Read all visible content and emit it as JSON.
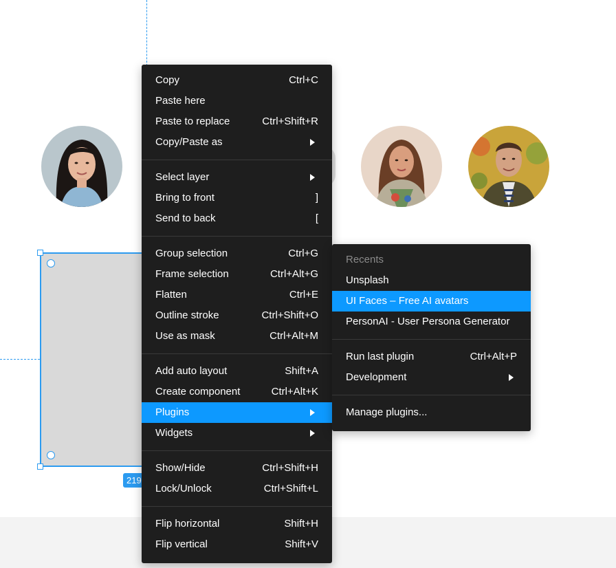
{
  "colors": {
    "accent": "#0d99ff",
    "selection": "#2c9bf0",
    "menu_bg": "#1e1e1e",
    "menu_text": "#ffffff",
    "muted_text": "#8a8a8a",
    "shape_fill": "#d9d9d9"
  },
  "canvas": {
    "size_badge": "219"
  },
  "context_menu": {
    "groups": [
      [
        {
          "label": "Copy",
          "shortcut": "Ctrl+C"
        },
        {
          "label": "Paste here",
          "shortcut": ""
        },
        {
          "label": "Paste to replace",
          "shortcut": "Ctrl+Shift+R"
        },
        {
          "label": "Copy/Paste as",
          "shortcut": "",
          "submenu": true
        }
      ],
      [
        {
          "label": "Select layer",
          "shortcut": "",
          "submenu": true
        },
        {
          "label": "Bring to front",
          "shortcut": "]"
        },
        {
          "label": "Send to back",
          "shortcut": "["
        }
      ],
      [
        {
          "label": "Group selection",
          "shortcut": "Ctrl+G"
        },
        {
          "label": "Frame selection",
          "shortcut": "Ctrl+Alt+G"
        },
        {
          "label": "Flatten",
          "shortcut": "Ctrl+E"
        },
        {
          "label": "Outline stroke",
          "shortcut": "Ctrl+Shift+O"
        },
        {
          "label": "Use as mask",
          "shortcut": "Ctrl+Alt+M"
        }
      ],
      [
        {
          "label": "Add auto layout",
          "shortcut": "Shift+A"
        },
        {
          "label": "Create component",
          "shortcut": "Ctrl+Alt+K"
        },
        {
          "label": "Plugins",
          "shortcut": "",
          "submenu": true,
          "active": true
        },
        {
          "label": "Widgets",
          "shortcut": "",
          "submenu": true
        }
      ],
      [
        {
          "label": "Show/Hide",
          "shortcut": "Ctrl+Shift+H"
        },
        {
          "label": "Lock/Unlock",
          "shortcut": "Ctrl+Shift+L"
        }
      ],
      [
        {
          "label": "Flip horizontal",
          "shortcut": "Shift+H"
        },
        {
          "label": "Flip vertical",
          "shortcut": "Shift+V"
        }
      ]
    ]
  },
  "plugins_submenu": {
    "recents_label": "Recents",
    "recents": [
      {
        "label": "Unsplash"
      },
      {
        "label": "UI Faces – Free AI avatars",
        "active": true
      },
      {
        "label": "PersonAI - User Persona Generator"
      }
    ],
    "actions": [
      {
        "label": "Run last plugin",
        "shortcut": "Ctrl+Alt+P"
      },
      {
        "label": "Development",
        "shortcut": "",
        "submenu": true
      }
    ],
    "manage": [
      {
        "label": "Manage plugins..."
      }
    ]
  }
}
